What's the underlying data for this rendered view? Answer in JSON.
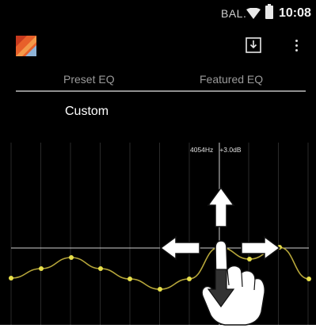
{
  "status_bar": {
    "carrier": "BAL.",
    "time": "10:08",
    "wifi_icon": "wifi-icon",
    "battery_icon": "battery-icon"
  },
  "app_bar": {
    "logo_icon": "app-logo-icon",
    "actions": [
      "save-preset-icon",
      "overflow-menu-icon"
    ]
  },
  "tabs": [
    {
      "label": "Preset EQ"
    },
    {
      "label": "Featured EQ"
    }
  ],
  "preset": {
    "name": "Custom"
  },
  "eq": {
    "band_frequency": "4054Hz",
    "band_gain": "+3.0dB",
    "band_count": 11,
    "selected_band": 7,
    "curve_color": "#b5a53a",
    "point_color": "#e8e04a"
  },
  "gesture_hint": {
    "arrows": [
      "arrow-up-icon",
      "arrow-down-icon",
      "arrow-left-icon",
      "arrow-right-icon"
    ],
    "hand_icon": "pointing-hand-icon"
  }
}
